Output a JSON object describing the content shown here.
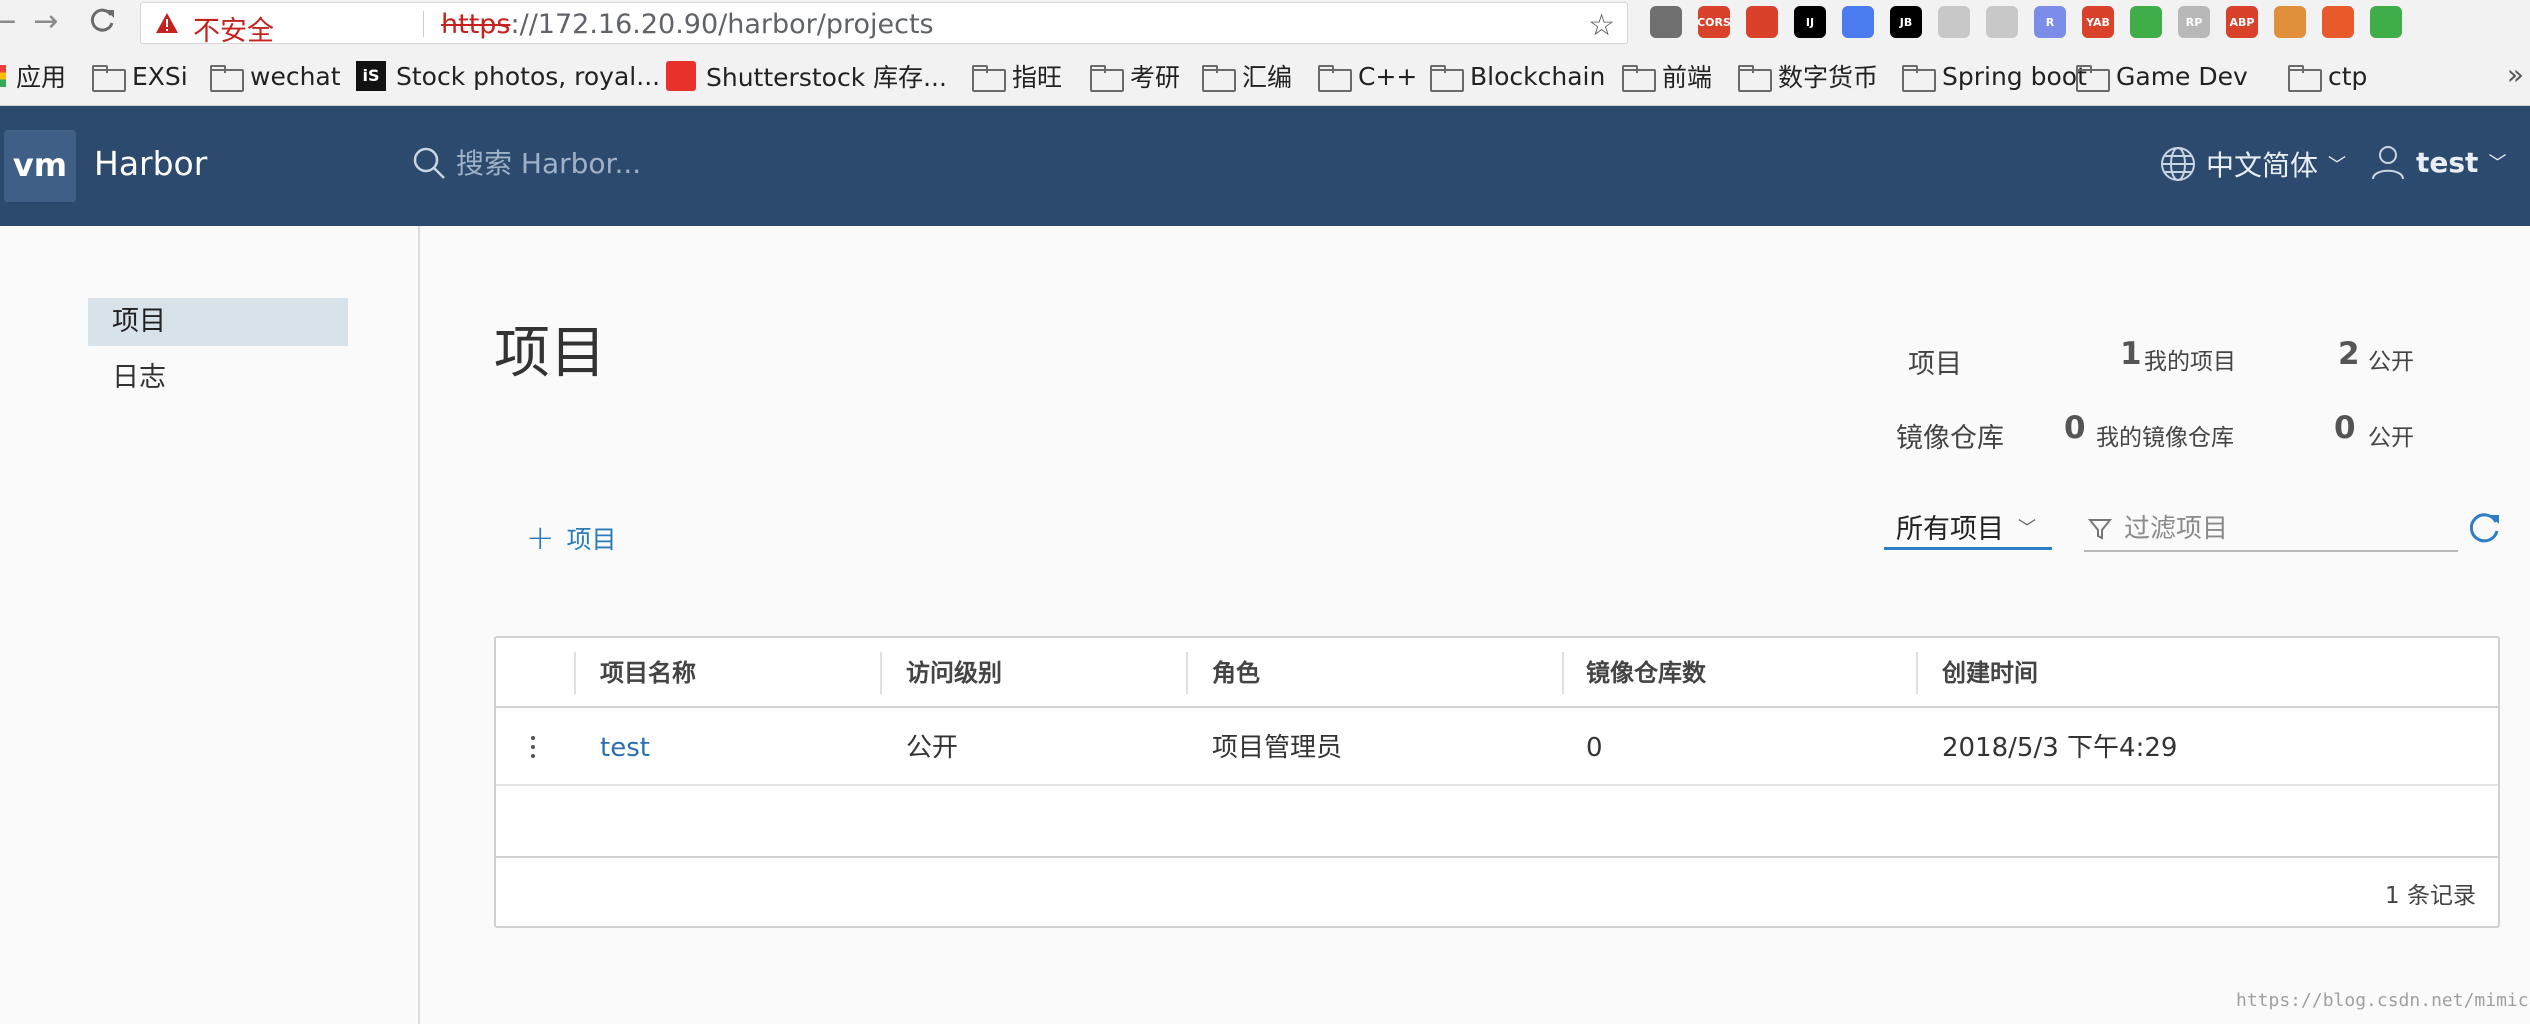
{
  "browser": {
    "insecure_label": "不安全",
    "url_scheme": "https",
    "url_rest": "://172.16.20.90/harbor/projects",
    "extensions": [
      {
        "label": "",
        "color": "#6f6f6f"
      },
      {
        "label": "CORS",
        "color": "#d9412b"
      },
      {
        "label": "",
        "color": "#d9412b"
      },
      {
        "label": "IJ",
        "color": "#000000"
      },
      {
        "label": "",
        "color": "#4a7cf0"
      },
      {
        "label": "JB",
        "color": "#000000"
      },
      {
        "label": "",
        "color": "#c8c8c8"
      },
      {
        "label": "",
        "color": "#c8c8c8"
      },
      {
        "label": "R",
        "color": "#7b8de8"
      },
      {
        "label": "YAB",
        "color": "#d9412b"
      },
      {
        "label": "",
        "color": "#3fae49"
      },
      {
        "label": "RP",
        "color": "#b8b8b8"
      },
      {
        "label": "ABP",
        "color": "#d9412b"
      },
      {
        "label": "",
        "color": "#e0903a"
      },
      {
        "label": "",
        "color": "#e85a2a"
      },
      {
        "label": "",
        "color": "#3fae49"
      }
    ]
  },
  "bookmarks": {
    "apps": "应用",
    "items": [
      {
        "label": "EXSi",
        "type": "folder"
      },
      {
        "label": "wechat",
        "type": "folder"
      },
      {
        "label": "Stock photos, royal...",
        "type": "site-is"
      },
      {
        "label": "Shutterstock 库存...",
        "type": "site-ss"
      },
      {
        "label": "指旺",
        "type": "folder"
      },
      {
        "label": "考研",
        "type": "folder"
      },
      {
        "label": "汇编",
        "type": "folder"
      },
      {
        "label": "C++",
        "type": "folder"
      },
      {
        "label": "Blockchain",
        "type": "folder"
      },
      {
        "label": "前端",
        "type": "folder"
      },
      {
        "label": "数字货币",
        "type": "folder"
      },
      {
        "label": "Spring boot",
        "type": "folder"
      },
      {
        "label": "Game Dev",
        "type": "folder"
      },
      {
        "label": "ctp",
        "type": "folder"
      }
    ],
    "more": "»"
  },
  "header": {
    "logo": "vm",
    "brand": "Harbor",
    "search_placeholder": "搜索 Harbor...",
    "language": "中文简体",
    "user": "test"
  },
  "sidebar": {
    "items": [
      {
        "label": "项目",
        "active": true
      },
      {
        "label": "日志",
        "active": false
      }
    ]
  },
  "main": {
    "title": "项目",
    "stats": {
      "projects_label": "项目",
      "my_projects_count": "1",
      "my_projects_label": "我的项目",
      "public_projects_count": "2",
      "public_label": "公开",
      "repos_label": "镜像仓库",
      "my_repos_count": "0",
      "my_repos_label": "我的镜像仓库",
      "public_repos_count": "0",
      "public_repos_label": "公开"
    },
    "add_project_label": "项目",
    "filter_select_value": "所有项目",
    "filter_placeholder": "过滤项目"
  },
  "table": {
    "columns": [
      "项目名称",
      "访问级别",
      "角色",
      "镜像仓库数",
      "创建时间"
    ],
    "rows": [
      {
        "name": "test",
        "access": "公开",
        "role": "项目管理员",
        "repo_count": "0",
        "created": "2018/5/3 下午4:29"
      }
    ],
    "footer_count": "1 条记录"
  },
  "watermark": "https://blog.csdn.net/mimica"
}
